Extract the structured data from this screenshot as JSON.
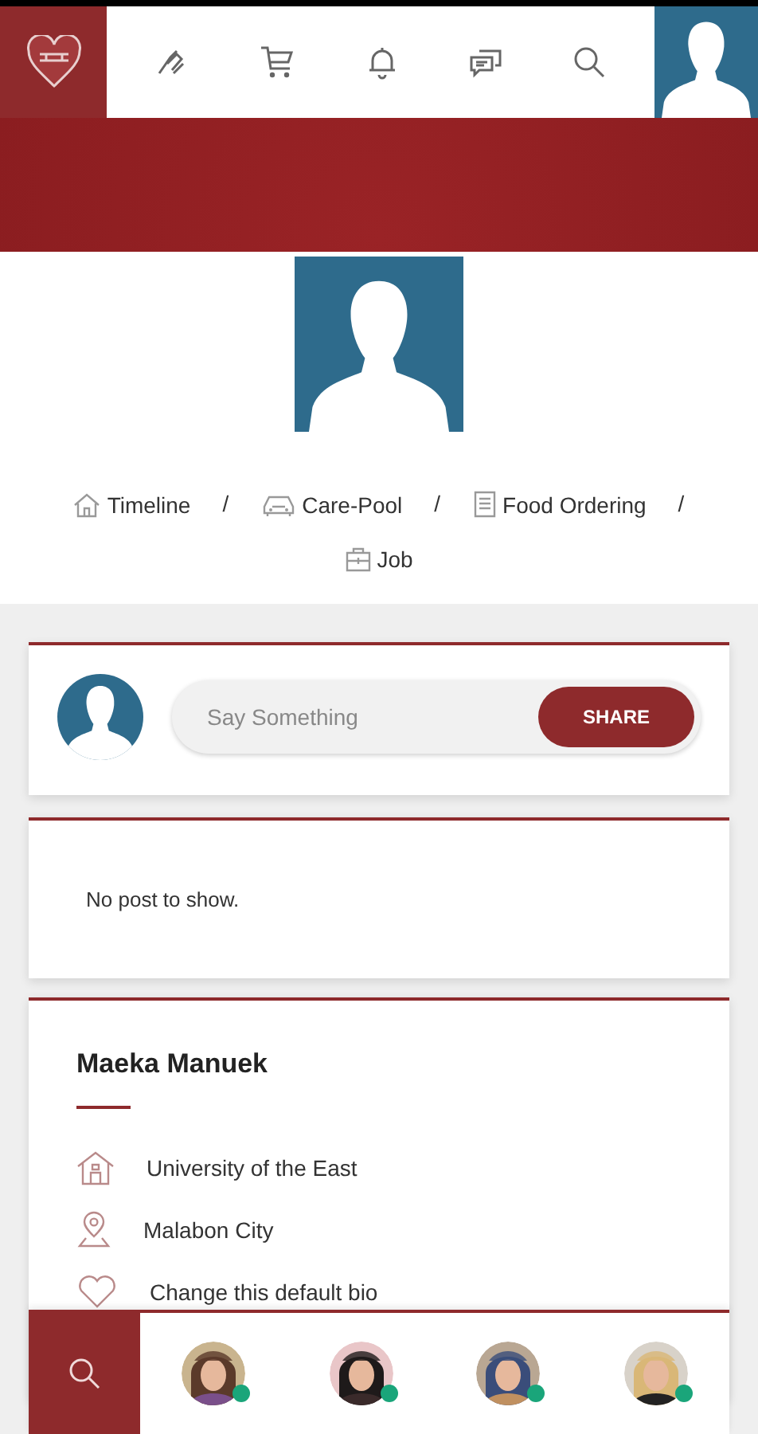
{
  "top_nav": {
    "items": [
      {
        "kind": "services",
        "selected": false
      },
      {
        "kind": "cart",
        "selected": false
      },
      {
        "kind": "bell",
        "selected": false
      },
      {
        "kind": "chat",
        "selected": false
      },
      {
        "kind": "search",
        "selected": false
      }
    ]
  },
  "profile_links": [
    {
      "kind": "home",
      "label": "Timeline",
      "separator": "/"
    },
    {
      "kind": "car",
      "label": "Care-Pool",
      "separator": "/"
    },
    {
      "kind": "menu",
      "label": "Food Ordering",
      "separator": "/"
    },
    {
      "kind": "job",
      "label": "Job"
    }
  ],
  "composer": {
    "placeholder": "Say Something",
    "button": "SHARE"
  },
  "posts": {
    "empty_text": "No post to show."
  },
  "about": {
    "name": "Maeka Manuek",
    "rows": [
      {
        "kind": "school",
        "text": "University of the East"
      },
      {
        "kind": "place",
        "text": "Malabon City"
      },
      {
        "kind": "bio",
        "text": "Change this default bio"
      }
    ]
  },
  "friends_bar": {
    "friends": [
      {
        "kind": "picture",
        "online": true
      },
      {
        "kind": "picture",
        "online": true
      },
      {
        "kind": "picture",
        "online": true
      },
      {
        "kind": "picture",
        "online": true
      }
    ]
  }
}
